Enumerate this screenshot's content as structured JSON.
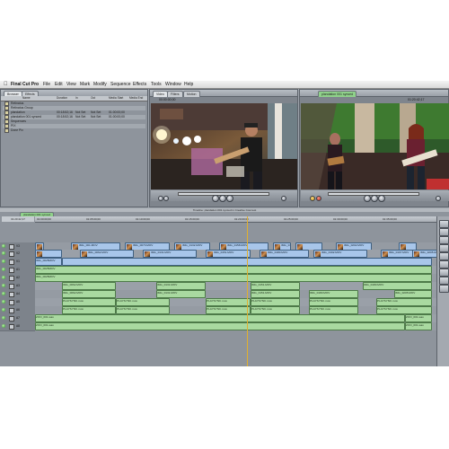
{
  "menubar": {
    "app": "Final Cut Pro",
    "items": [
      "File",
      "Edit",
      "View",
      "Mark",
      "Modify",
      "Sequence",
      "Effects",
      "Tools",
      "Window",
      "Help"
    ]
  },
  "browser": {
    "tabs": [
      "Browser",
      "Effects"
    ],
    "columns": [
      "Name",
      "Duration",
      "In",
      "Out",
      "Media Start",
      "Media End"
    ],
    "rows": [
      {
        "name": "Retinatus",
        "duration": "",
        "in": "",
        "out": "",
        "start": "",
        "end": ""
      },
      {
        "name": "Retinatus Group",
        "duration": "",
        "in": "",
        "out": "",
        "start": "",
        "end": ""
      },
      {
        "name": "plandation",
        "duration": "00:18:52;16",
        "in": "Not Set",
        "out": "Not Set",
        "start": "01:00:00;00",
        "end": ""
      },
      {
        "name": "plandation 001 synced",
        "duration": "00:18:52;16",
        "in": "Not Set",
        "out": "Not Set",
        "start": "01:00:00;00",
        "end": ""
      },
      {
        "name": "Sequences",
        "duration": "",
        "in": "",
        "out": "",
        "start": "",
        "end": ""
      },
      {
        "name": "PIX",
        "duration": "",
        "in": "",
        "out": "",
        "start": "",
        "end": ""
      },
      {
        "name": "Done Pix",
        "duration": "",
        "in": "",
        "out": "",
        "start": "",
        "end": ""
      }
    ]
  },
  "viewer": {
    "tabs": [
      "Video",
      "Filters",
      "Motion"
    ],
    "timecode": "00:00:00;00"
  },
  "canvas": {
    "tab": "plandation 001 synced",
    "timecode": "01:20:42;17"
  },
  "timeline": {
    "title": "Timeline: plandation 001 synced in Creative Cow test",
    "sequence_tab": "plandation 001 synced",
    "current_time": "01:20:42;17",
    "ruler_ticks": [
      "01:00:00;00",
      "01:05:00;00",
      "01:10:00;00",
      "01:15:00;00",
      "01:20:00;00",
      "01:25:00;00",
      "01:30:00;00",
      "01:35:00;00"
    ],
    "tracks": [
      {
        "name": "V3",
        "kind": "v",
        "clips": [
          "",
          "IMG_001.MOV",
          "IMG_0073.MOV",
          "IMG_0132.MOV",
          "IMG_0158.MOV",
          "IMG_0184.MOV",
          "",
          "IMG_0202.MOV",
          ""
        ]
      },
      {
        "name": "V2",
        "kind": "v",
        "clips": [
          "",
          "IMG_0062.MOV",
          "IMG_0131.MOV",
          "IMG_0151.MOV",
          "IMG_0180.MOV",
          "IMG_0192.MOV",
          "IMG_0197.MOV",
          "IMG_0205.MOV"
        ]
      },
      {
        "name": "V1",
        "kind": "v",
        "clips": [
          "IMG_0025MOV",
          ""
        ]
      },
      {
        "name": "A1",
        "kind": "a",
        "clips": [
          "IMG_0025MOV"
        ]
      },
      {
        "name": "A2",
        "kind": "a",
        "clips": [
          "IMG_0025MOV"
        ]
      },
      {
        "name": "A3",
        "kind": "a",
        "clips": [
          "IMG_0062.MOV",
          "IMG_0131.MOV",
          "IMG_0151.MOV",
          "IMG_0180.MOV"
        ]
      },
      {
        "name": "A4",
        "kind": "a",
        "clips": [
          "IMG_0062.MOV",
          "IMG_0131.MOV",
          "IMG_0151.MOV",
          "IMG_0180.MOV",
          "IMG_0205.MOV"
        ]
      },
      {
        "name": "A5",
        "kind": "a",
        "clips": [
          "PLAYSYNC.mov",
          "PLAYSYNC.mov",
          "PLAYSYNC.mov",
          "PLAYSYNC.mov",
          "PLAYSYNC.mov",
          "PLAYSYNC.mov"
        ]
      },
      {
        "name": "A6",
        "kind": "a",
        "clips": [
          "PLAYSYNC.mov",
          "PLAYSYNC.mov",
          "PLAYSYNC.mov",
          "PLAYSYNC.mov",
          "PLAYSYNC.mov",
          "PLAYSYNC.mov"
        ]
      },
      {
        "name": "A7",
        "kind": "a",
        "clips": [
          "ZOO_001.wav",
          "ZOO_001.wav"
        ]
      },
      {
        "name": "A8",
        "kind": "a",
        "clips": [
          "ZOO_001.wav",
          "ZOO_001.wav"
        ]
      }
    ]
  }
}
